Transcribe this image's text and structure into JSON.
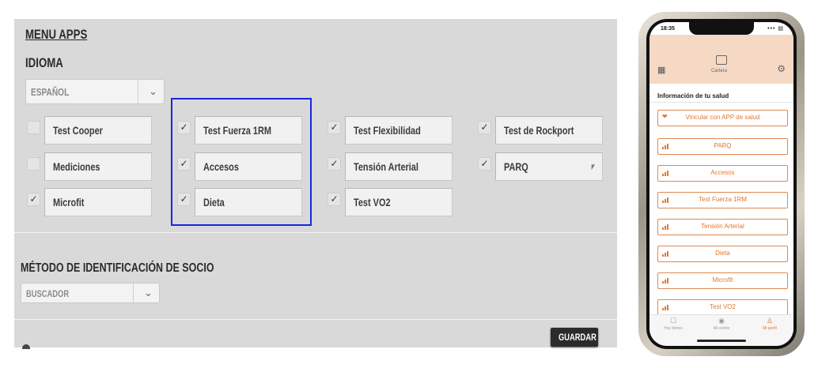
{
  "admin": {
    "menu_title": "MENU APPS",
    "idioma_title": "IDIOMA",
    "language_value": "ESPAÑOL",
    "apps": [
      {
        "label": "Test Cooper",
        "checked": false
      },
      {
        "label": "Test Fuerza 1RM",
        "checked": true
      },
      {
        "label": "Test Flexibilidad",
        "checked": true
      },
      {
        "label": "Test de Rockport",
        "checked": true
      },
      {
        "label": "Mediciones",
        "checked": false
      },
      {
        "label": "Accesos",
        "checked": true
      },
      {
        "label": "Tensión Arterial",
        "checked": true
      },
      {
        "label": "PARQ",
        "checked": true
      },
      {
        "label": "Microfit",
        "checked": true
      },
      {
        "label": "Dieta",
        "checked": true
      },
      {
        "label": "Test VO2",
        "checked": true
      }
    ],
    "metodo_title": "MÉTODO DE IDENTIFICACIÓN DE SOCIO",
    "metodo_value": "BUSCADOR",
    "save_label": "GUARDAR"
  },
  "phone": {
    "time": "18:35",
    "wallet_label": "Cartera",
    "section_title": "Información de tu salud",
    "items": [
      {
        "label": "Vincular con APP de salud",
        "icon": "heart-icon"
      },
      {
        "label": "PARQ",
        "icon": "bars-icon"
      },
      {
        "label": "Accesos",
        "icon": "bars-icon"
      },
      {
        "label": "Test Fuerza 1RM",
        "icon": "bars-icon"
      },
      {
        "label": "Tensión Arterial",
        "icon": "bars-icon"
      },
      {
        "label": "Dieta",
        "icon": "bars-icon"
      },
      {
        "label": "Microfit",
        "icon": "bars-icon"
      },
      {
        "label": "Test VO2",
        "icon": "bars-icon"
      }
    ],
    "tabs": [
      {
        "label": "Hoy tienes",
        "icon": "calendar-icon",
        "active": false
      },
      {
        "label": "Mi centro",
        "icon": "location-icon",
        "active": false
      },
      {
        "label": "Mi perfil",
        "icon": "user-icon",
        "active": true
      }
    ],
    "accent_color": "#e2782e"
  }
}
